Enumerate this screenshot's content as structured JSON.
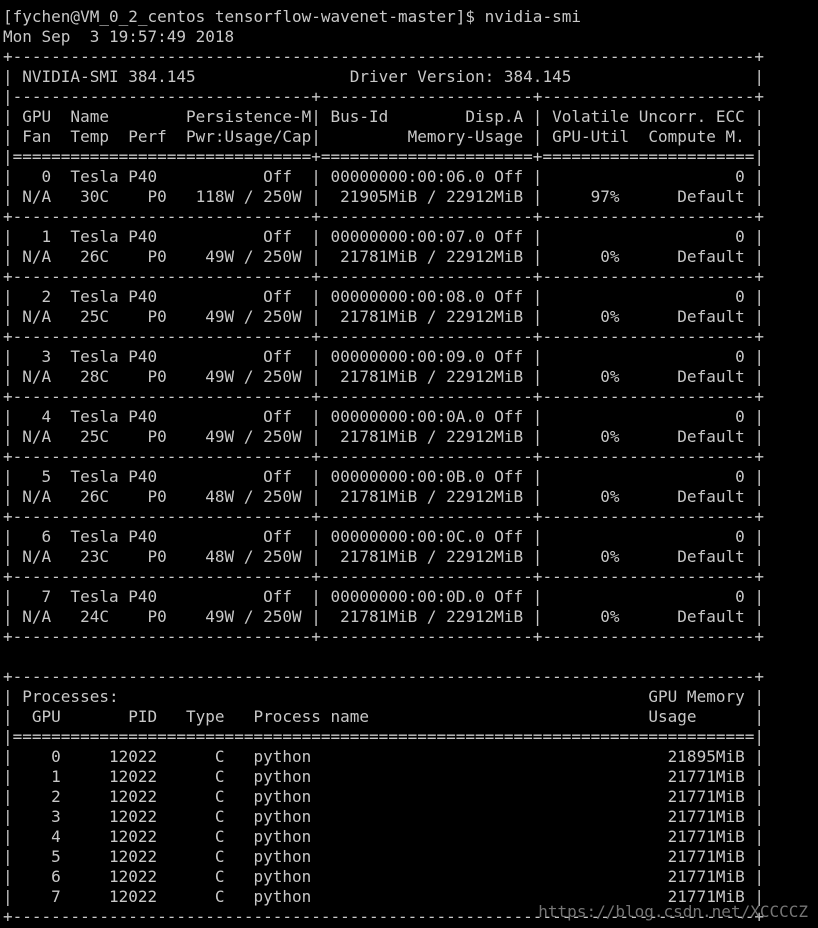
{
  "terminal": {
    "lines": [
      "[fychen@VM_0_2_centos tensorflow-wavenet-master]$ nvidia-smi",
      "Mon Sep  3 19:57:49 2018",
      "+-----------------------------------------------------------------------------+",
      "| NVIDIA-SMI 384.145                Driver Version: 384.145                   |",
      "|-------------------------------+----------------------+----------------------+",
      "| GPU  Name        Persistence-M| Bus-Id        Disp.A | Volatile Uncorr. ECC |",
      "| Fan  Temp  Perf  Pwr:Usage/Cap|         Memory-Usage | GPU-Util  Compute M. |",
      "|===============================+======================+======================|",
      "|   0  Tesla P40           Off  | 00000000:00:06.0 Off |                    0 |",
      "| N/A   30C    P0   118W / 250W |  21905MiB / 22912MiB |     97%      Default |",
      "+-------------------------------+----------------------+----------------------+",
      "|   1  Tesla P40           Off  | 00000000:00:07.0 Off |                    0 |",
      "| N/A   26C    P0    49W / 250W |  21781MiB / 22912MiB |      0%      Default |",
      "+-------------------------------+----------------------+----------------------+",
      "|   2  Tesla P40           Off  | 00000000:00:08.0 Off |                    0 |",
      "| N/A   25C    P0    49W / 250W |  21781MiB / 22912MiB |      0%      Default |",
      "+-------------------------------+----------------------+----------------------+",
      "|   3  Tesla P40           Off  | 00000000:00:09.0 Off |                    0 |",
      "| N/A   28C    P0    49W / 250W |  21781MiB / 22912MiB |      0%      Default |",
      "+-------------------------------+----------------------+----------------------+",
      "|   4  Tesla P40           Off  | 00000000:00:0A.0 Off |                    0 |",
      "| N/A   25C    P0    49W / 250W |  21781MiB / 22912MiB |      0%      Default |",
      "+-------------------------------+----------------------+----------------------+",
      "|   5  Tesla P40           Off  | 00000000:00:0B.0 Off |                    0 |",
      "| N/A   26C    P0    48W / 250W |  21781MiB / 22912MiB |      0%      Default |",
      "+-------------------------------+----------------------+----------------------+",
      "|   6  Tesla P40           Off  | 00000000:00:0C.0 Off |                    0 |",
      "| N/A   23C    P0    48W / 250W |  21781MiB / 22912MiB |      0%      Default |",
      "+-------------------------------+----------------------+----------------------+",
      "|   7  Tesla P40           Off  | 00000000:00:0D.0 Off |                    0 |",
      "| N/A   24C    P0    49W / 250W |  21781MiB / 22912MiB |      0%      Default |",
      "+-------------------------------+----------------------+----------------------+",
      "",
      "+-----------------------------------------------------------------------------+",
      "| Processes:                                                       GPU Memory |",
      "|  GPU       PID   Type   Process name                             Usage      |",
      "|=============================================================================|",
      "|    0     12022      C   python                                     21895MiB |",
      "|    1     12022      C   python                                     21771MiB |",
      "|    2     12022      C   python                                     21771MiB |",
      "|    3     12022      C   python                                     21771MiB |",
      "|    4     12022      C   python                                     21771MiB |",
      "|    5     12022      C   python                                     21771MiB |",
      "|    6     12022      C   python                                     21771MiB |",
      "|    7     12022      C   python                                     21771MiB |",
      "+-----------------------------------------------------------------------------+"
    ]
  },
  "watermark": "https://blog.csdn.net/XCCCCZ",
  "colors": {
    "background": "#000000",
    "text": "#c8c8c8",
    "watermark": "#8a8a8a"
  }
}
